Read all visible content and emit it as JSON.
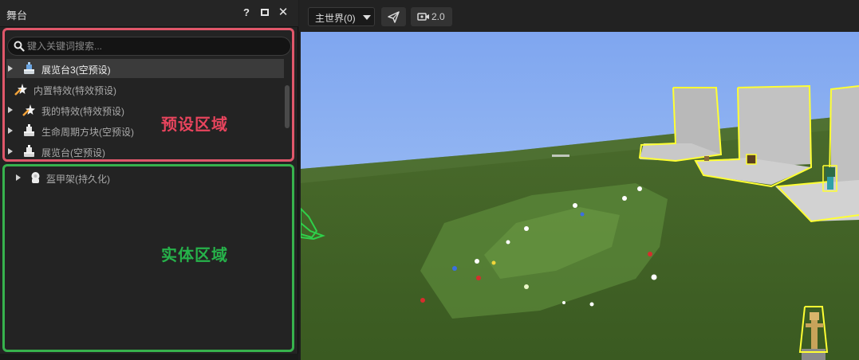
{
  "panel": {
    "title": "舞台",
    "help_label": "?",
    "close_label": "✕"
  },
  "search": {
    "placeholder": "键入关键词搜索..."
  },
  "presets": [
    {
      "label": "展览台3(空预设)",
      "icon": "display-stand-icon",
      "expandable": true,
      "selected": true
    },
    {
      "label": "内置特效(特效预设)",
      "icon": "star-effect-icon",
      "expandable": false,
      "selected": false
    },
    {
      "label": "我的特效(特效预设)",
      "icon": "star-effect-icon",
      "expandable": true,
      "selected": false
    },
    {
      "label": "生命周期方块(空预设)",
      "icon": "display-stand-icon",
      "expandable": true,
      "selected": false
    },
    {
      "label": "展览台(空预设)",
      "icon": "display-stand-icon",
      "expandable": true,
      "selected": false
    }
  ],
  "entities": [
    {
      "label": "盔甲架(持久化)",
      "icon": "armor-stand-icon",
      "expandable": true
    }
  ],
  "annotations": {
    "preset_area": "预设区域",
    "entity_area": "实体区域"
  },
  "toolbar": {
    "world_select": "主世界(0)",
    "camera_speed": "2.0"
  },
  "colors": {
    "preset_area_border": "#e0576a",
    "entity_area_border": "#37b24d",
    "selection_highlight": "#ffff33"
  }
}
